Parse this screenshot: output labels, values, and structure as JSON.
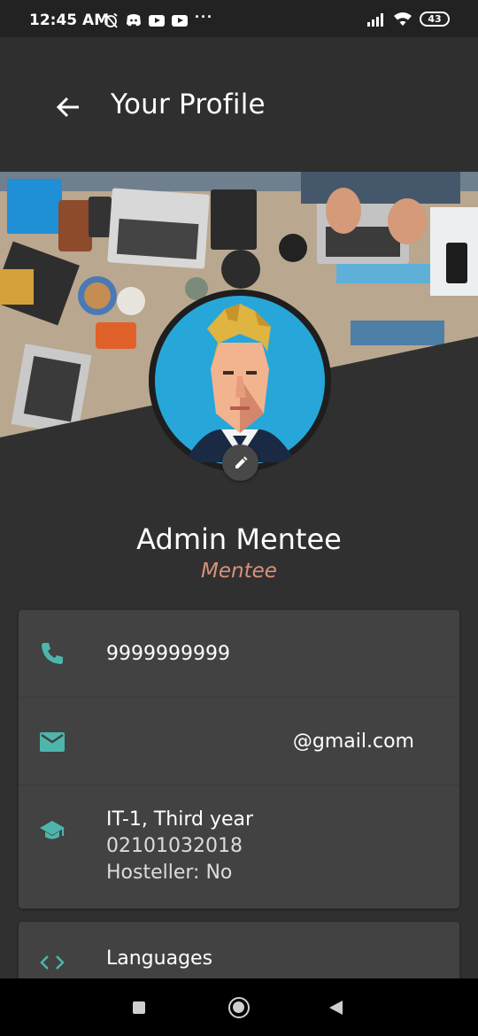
{
  "status_bar": {
    "time": "12:45 AM",
    "battery": "43",
    "icons": [
      "alarm-off-icon",
      "discord-icon",
      "youtube-icon",
      "youtube-icon",
      "more-dots-icon",
      "signal-icon",
      "wifi-icon",
      "battery-icon"
    ]
  },
  "app_bar": {
    "title": "Your Profile",
    "back_icon": "arrow-back-icon"
  },
  "profile": {
    "name": "Admin Mentee",
    "role": "Mentee",
    "edit_icon": "pencil-icon"
  },
  "contact": {
    "phone": "9999999999",
    "email": "@gmail.com",
    "education_line1": "IT-1, Third year",
    "education_line2": "02101032018",
    "education_line3": "Hosteller: No"
  },
  "skills": {
    "label": "Languages"
  },
  "colors": {
    "accent_teal": "#4db6ac",
    "role_color": "#d8917a",
    "background": "#303030",
    "card": "#424242"
  }
}
